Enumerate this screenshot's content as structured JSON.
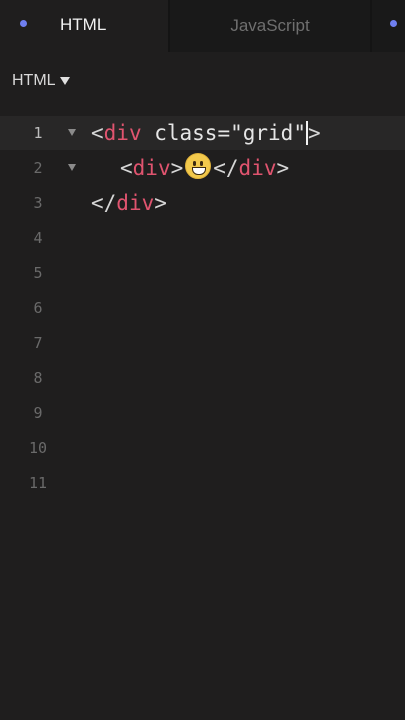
{
  "tabs": [
    {
      "label": "HTML",
      "active": true
    },
    {
      "label": "JavaScript",
      "active": false
    }
  ],
  "language_select": {
    "value": "HTML"
  },
  "editor": {
    "lines": [
      {
        "number": "1",
        "tokens": {
          "open": "<",
          "tag": "div",
          "attr": " class=",
          "str": "\"grid\"",
          "close": ">"
        }
      },
      {
        "number": "2",
        "tokens": {
          "open": "<",
          "tag": "div",
          "close": ">",
          "emoji": "grinning-face",
          "open2": "</",
          "tag2": "div",
          "close2": ">"
        }
      },
      {
        "number": "3",
        "tokens": {
          "open": "</",
          "tag": "div",
          "close": ">"
        }
      },
      {
        "number": "4"
      },
      {
        "number": "5"
      },
      {
        "number": "6"
      },
      {
        "number": "7"
      },
      {
        "number": "8"
      },
      {
        "number": "9"
      },
      {
        "number": "10"
      },
      {
        "number": "11"
      }
    ]
  },
  "colors": {
    "background": "#1f1e1e",
    "tag": "#e0546f",
    "tab_dot": "#6f7ff0"
  }
}
